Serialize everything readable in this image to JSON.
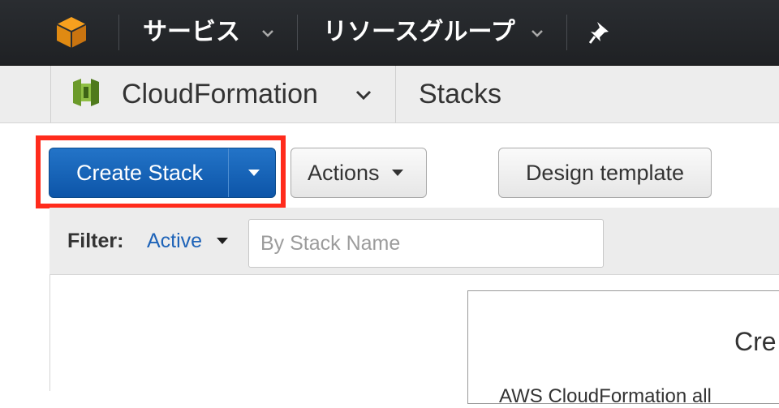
{
  "topnav": {
    "services_label": "サービス",
    "resource_groups_label": "リソースグループ",
    "icons": [
      "aws-cube-icon",
      "chevron-down-icon",
      "pin-icon"
    ]
  },
  "subnav": {
    "service_name": "CloudFormation",
    "breadcrumb": "Stacks"
  },
  "toolbar": {
    "create_stack_label": "Create Stack",
    "actions_label": "Actions",
    "design_template_label": "Design template"
  },
  "filter": {
    "label": "Filter:",
    "selected": "Active",
    "search_placeholder": "By Stack Name"
  },
  "welcome": {
    "title_partial": "Cre",
    "desc_partial": "AWS CloudFormation all"
  },
  "colors": {
    "primary_button": "#0d55a8",
    "highlight": "#ff2b1c",
    "link": "#1e63b8",
    "topnav": "#232f3e"
  }
}
